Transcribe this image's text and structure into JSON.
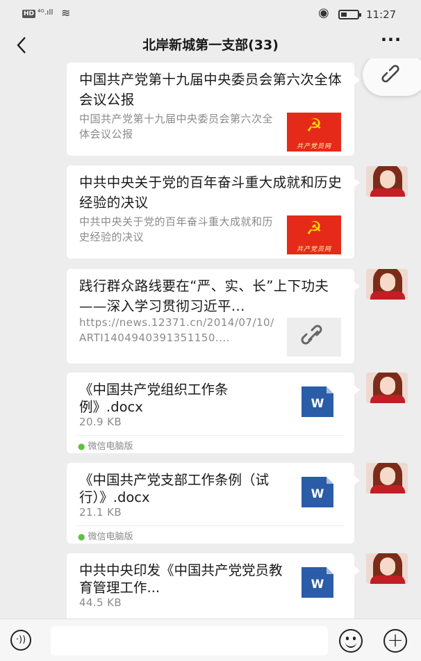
{
  "status_bar": {
    "hd": "HD",
    "network": "⁴ᴳ.ıll",
    "time": "11:27"
  },
  "header": {
    "back_icon": "chevron-left-icon",
    "title": "北岸新城第一支部(33)",
    "more_label": "···"
  },
  "messages": [
    {
      "type": "article",
      "title": "中国共产党第十九届中央委员会第六次全体会议公报",
      "description": "中国共产党第十九届中央委员会第六次全体会议公报",
      "thumb_symbol": "☭",
      "thumb_caption": "共产党员网"
    },
    {
      "type": "article",
      "title": "中共中央关于党的百年奋斗重大成就和历史经验的决议",
      "description": "中共中央关于党的百年奋斗重大成就和历史经验的决议",
      "thumb_symbol": "☭",
      "thumb_caption": "共产党员网"
    },
    {
      "type": "link",
      "title": "践行群众路线要在“严、实、长”上下功夫——深入学习贯彻习近平...",
      "description": "https://news.12371.cn/2014/07/10/ARTI1404940391351150....",
      "thumb_icon": "link-icon"
    },
    {
      "type": "file",
      "name": "《中国共产党组织工作条例》.docx",
      "size": "20.9 KB",
      "source": "微信电脑版",
      "file_icon": "W"
    },
    {
      "type": "file",
      "name": "《中国共产党支部工作条例（试行）》.docx",
      "size": "21.1 KB",
      "source": "微信电脑版",
      "file_icon": "W"
    },
    {
      "type": "file",
      "name": "中共中央印发《中国共产党党员教育管理工作...",
      "size": "44.5 KB",
      "file_icon": "W"
    }
  ],
  "floating_button": {
    "icon": "link-icon"
  },
  "input_bar": {
    "voice_icon": "voice-icon",
    "voice_glyph": "·))",
    "input_value": "",
    "emoji_icon": "emoji-icon",
    "plus_icon": "plus-icon",
    "plus_glyph": "+"
  },
  "colors": {
    "background": "#ededed",
    "bubble": "#ffffff",
    "party_red": "#e62a19",
    "word_blue": "#2b5ca8",
    "muted_text": "#8a8a8a"
  }
}
